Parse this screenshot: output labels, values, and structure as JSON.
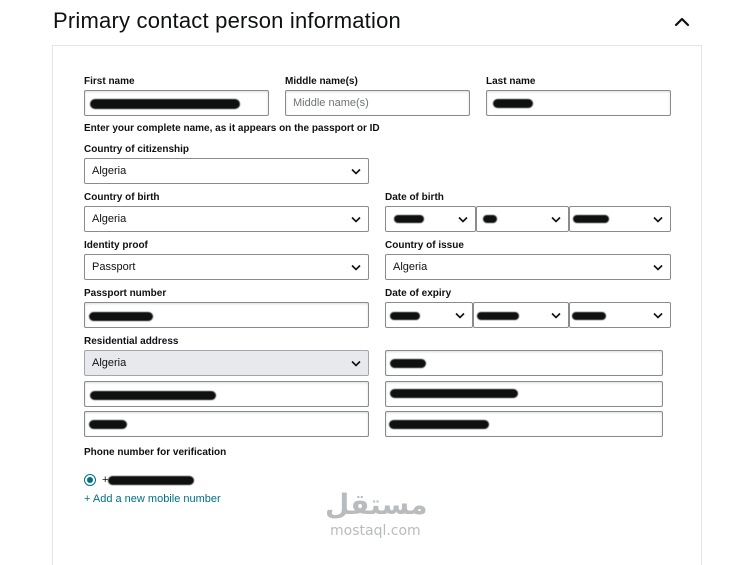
{
  "section": {
    "title": "Primary contact person information"
  },
  "form": {
    "first_name_label": "First name",
    "middle_name_label": "Middle name(s)",
    "middle_name_placeholder": "Middle name(s)",
    "last_name_label": "Last name",
    "name_hint": "Enter your complete name, as it appears on the passport or ID",
    "citizenship_label": "Country of citizenship",
    "citizenship_value": "Algeria",
    "birth_country_label": "Country of birth",
    "birth_country_value": "Algeria",
    "dob_label": "Date of birth",
    "identity_proof_label": "Identity proof",
    "identity_proof_value": "Passport",
    "issue_country_label": "Country of issue",
    "issue_country_value": "Algeria",
    "passport_number_label": "Passport number",
    "expiry_label": "Date of expiry",
    "address_label": "Residential address",
    "address_country_value": "Algeria",
    "phone_label": "Phone number for verification",
    "phone_prefix": "+",
    "add_number_link": "+ Add a new mobile number"
  },
  "watermark": {
    "arabic": "مستقل",
    "latin": "mostaql.com"
  },
  "icons": {
    "collapse": "chevron-up-icon",
    "dropdown": "chevron-down-icon"
  },
  "colors": {
    "link": "#007185",
    "radio": "#007185",
    "border": "#888c8c",
    "disabled_bg": "#e7e9ec"
  }
}
